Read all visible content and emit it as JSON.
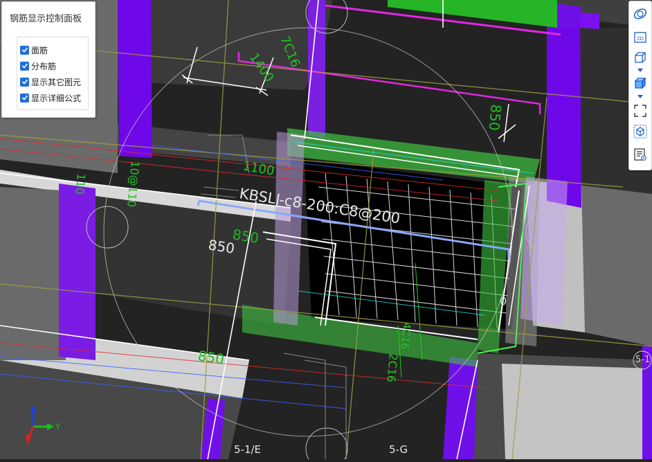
{
  "panel": {
    "title": "钢筋显示控制面板",
    "options": [
      {
        "label": "面筋",
        "checked": true
      },
      {
        "label": "分布筋",
        "checked": true
      },
      {
        "label": "显示其它图元",
        "checked": true
      },
      {
        "label": "显示详细公式",
        "checked": true
      }
    ]
  },
  "toolbar": {
    "buttons": [
      {
        "icon": "orbit-icon"
      },
      {
        "icon": "2d-view-icon",
        "label": "2D"
      },
      {
        "icon": "box-wireframe-icon"
      },
      {
        "icon": "box-solid-icon"
      },
      {
        "icon": "zoom-extents-icon"
      },
      {
        "icon": "3d-cube-icon"
      },
      {
        "icon": "properties-list-icon"
      }
    ]
  },
  "scene": {
    "rebar_label": "KBSLJ-c8-200:C8@200",
    "dim_850_a": "850",
    "dim_850_b": "850",
    "dim_850_c": "850",
    "dim_850_d": "850",
    "dim_1400": "1400",
    "dim_1100": "1100",
    "dim_top_rebar": "7C16",
    "dim_left_rebar": "10@110",
    "dim_left_rebar_b": "110",
    "dim_bottom_rebar": "4C16",
    "dim_bottom_rebar_b": "2C16",
    "dim_small": "0"
  },
  "grid_labels": {
    "axis_e": "5-1/E",
    "axis_g": "5-G",
    "axis_right": "5-1"
  },
  "axes": {
    "x": "X",
    "y": "Y",
    "z": "Z",
    "x_color": "#e02020",
    "y_color": "#16c016",
    "z_color": "#1e3ee0"
  },
  "colors": {
    "column": "#6f08e8",
    "beam_top": "#e8e8e8",
    "beam_side": "#3c3c3c",
    "rebar_green": "#22c422"
  }
}
